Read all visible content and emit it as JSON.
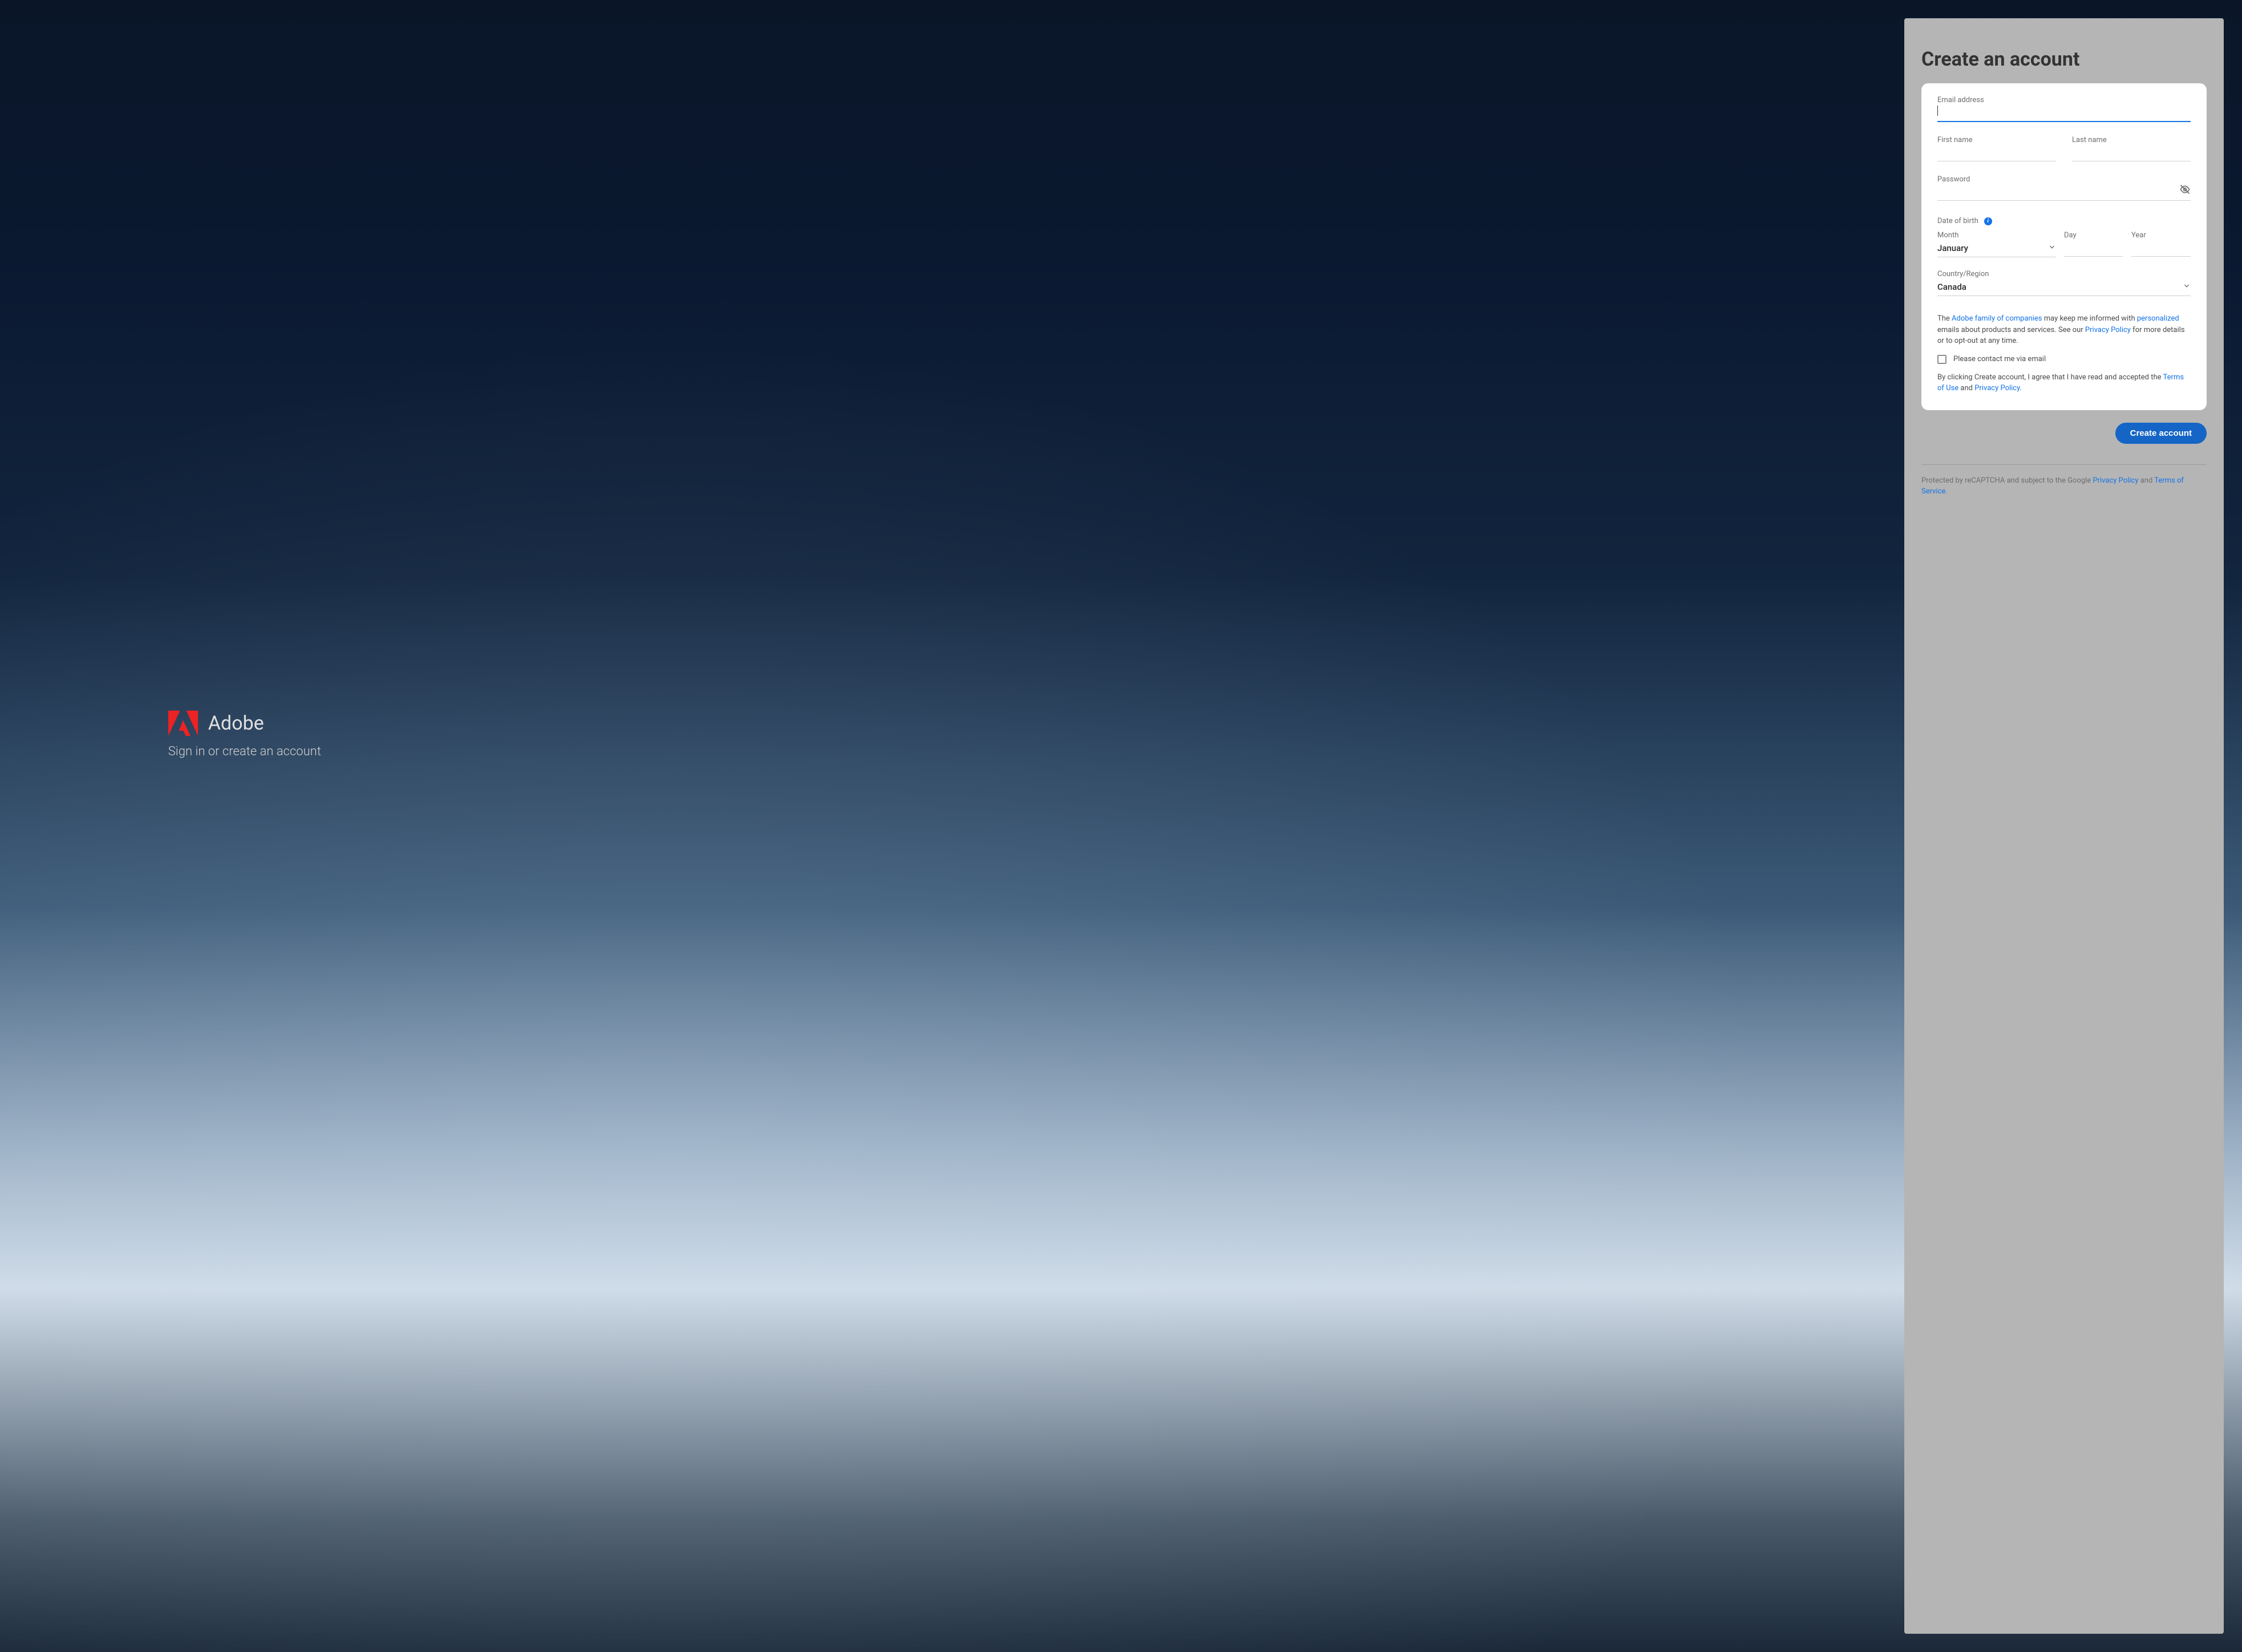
{
  "brand": {
    "name": "Adobe",
    "tagline": "Sign in or create an account"
  },
  "panel": {
    "title": "Create an account"
  },
  "form": {
    "email_label": "Email address",
    "email_value": "",
    "first_name_label": "First name",
    "first_name_value": "",
    "last_name_label": "Last name",
    "last_name_value": "",
    "password_label": "Password",
    "password_value": "",
    "dob_label": "Date of birth",
    "month_label": "Month",
    "month_value": "January",
    "day_label": "Day",
    "day_value": "",
    "year_label": "Year",
    "year_value": "",
    "country_label": "Country/Region",
    "country_value": "Canada"
  },
  "legal": {
    "prefix": "The ",
    "adobe_family_link": "Adobe family of companies",
    "mid1": " may keep me informed with ",
    "personalized_link": "personalized",
    "mid2": " emails about products and services. See our ",
    "privacy_link1": "Privacy Policy",
    "mid3": " for more details or to opt-out at any time.",
    "checkbox_label": "Please contact me via email",
    "agree_prefix": "By clicking Create account, I agree that I have read and accepted the ",
    "tou_link": "Terms of Use",
    "agree_and": " and ",
    "privacy_link2": "Privacy Policy",
    "agree_suffix": "."
  },
  "actions": {
    "create": "Create account"
  },
  "recaptcha": {
    "prefix": "Protected by reCAPTCHA and subject to the Google ",
    "privacy_link": "Privacy Policy",
    "and": " and ",
    "tos_link": "Terms of Service",
    "suffix": "."
  }
}
